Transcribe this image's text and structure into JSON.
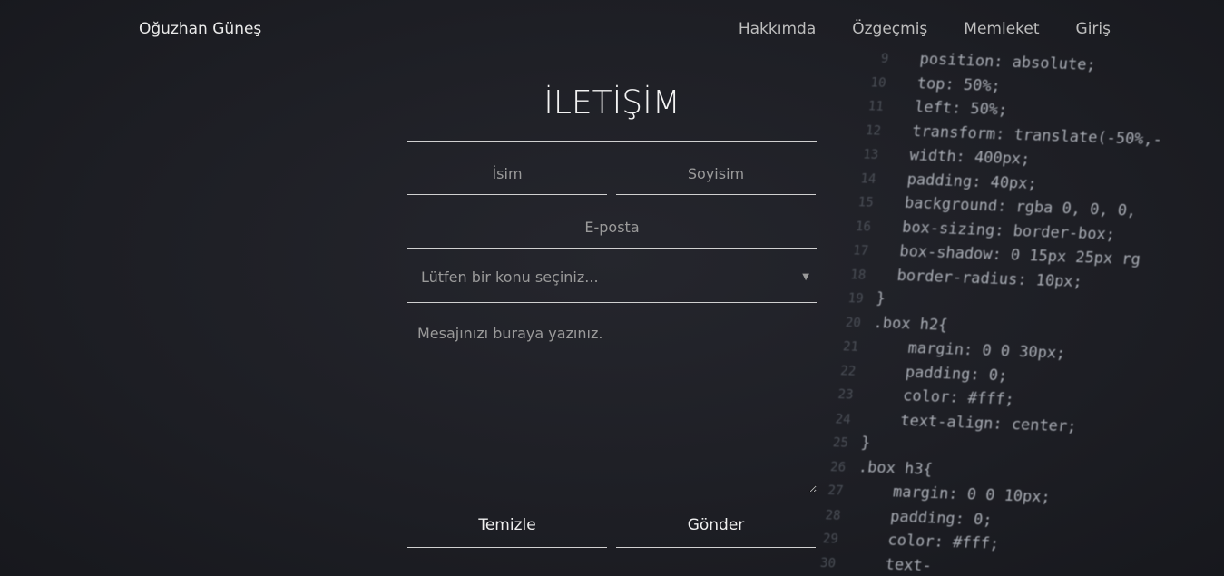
{
  "nav": {
    "brand": "Oğuzhan Güneş",
    "links": [
      "Hakkımda",
      "Özgeçmiş",
      "Memleket",
      "Giriş"
    ]
  },
  "form": {
    "title": "İLETİŞİM",
    "first_name_placeholder": "İsim",
    "last_name_placeholder": "Soyisim",
    "email_placeholder": "E-posta",
    "subject_placeholder": "Lütfen bir konu seçiniz...",
    "message_placeholder": "Mesajınızı buraya yazınız.",
    "reset_label": "Temizle",
    "submit_label": "Gönder"
  },
  "background_code": {
    "line_numbers": [
      "9",
      "10",
      "11",
      "12",
      "13",
      "14",
      "15",
      "16",
      "17",
      "18",
      "19",
      "20",
      "21",
      "22",
      "23",
      "24",
      "25",
      "26",
      "27",
      "28",
      "29",
      "30"
    ],
    "lines": [
      "  position: absolute;",
      "  top: 50%;",
      "  left: 50%;",
      "  transform: translate(-50%,-",
      "  width: 400px;",
      "  padding: 40px;",
      "  background: rgba 0, 0, 0,",
      "  box-sizing: border-box;",
      "  box-shadow: 0 15px 25px rg",
      "  border-radius: 10px;",
      "}",
      ".box h2{",
      "    margin: 0 0 30px;",
      "    padding: 0;",
      "    color: #fff;",
      "    text-align: center;",
      "}",
      ".box h3{",
      "    margin: 0 0 10px;",
      "    padding: 0;",
      "    color: #fff;",
      "    text-"
    ]
  },
  "colors": {
    "background": "#1f2026",
    "text": "#f3f3f3",
    "muted": "#9a9a9a",
    "line": "#d0d0d0"
  }
}
